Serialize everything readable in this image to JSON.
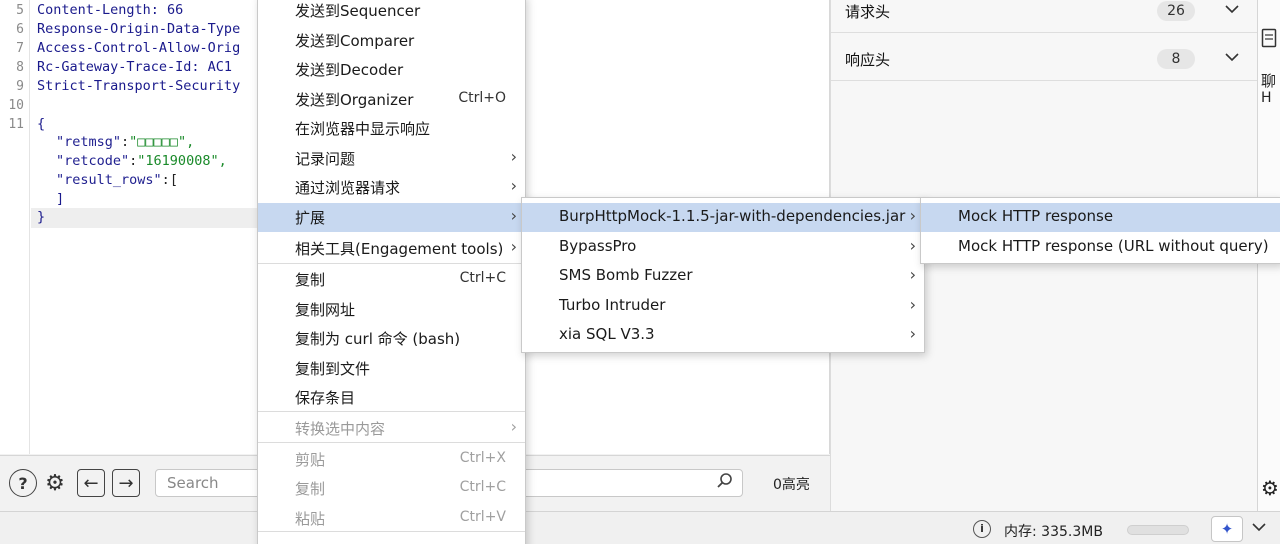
{
  "editor": {
    "line_numbers": [
      "5",
      "6",
      "7",
      "8",
      "9",
      "10",
      "11"
    ],
    "lines": [
      "Content-Length: 66",
      "Response-Origin-Data-Type",
      "Access-Control-Allow-Orig",
      "Rc-Gateway-Trace-Id: AC1",
      "Strict-Transport-Security",
      "",
      "{"
    ],
    "json_lines": [
      {
        "key": "\"retmsg\"",
        "value": "\"□□□□□\","
      },
      {
        "key": "\"retcode\"",
        "value": "\"16190008\","
      },
      {
        "key": "\"result_rows\"",
        "value": "["
      }
    ],
    "close_bracket": "]",
    "close_brace": "}"
  },
  "toolbar": {
    "search_placeholder": "Search",
    "highlight_count": "0高亮"
  },
  "inspector": {
    "rows": [
      {
        "label": "请求头",
        "count": "26"
      },
      {
        "label": "响应头",
        "count": "8"
      }
    ]
  },
  "rightstrip": {
    "text1": "聊",
    "text2": "H"
  },
  "statusbar": {
    "memory": "内存: 335.3MB"
  },
  "menu_main": {
    "items": [
      {
        "label": "发送到Sequencer",
        "shortcut": ""
      },
      {
        "label": "发送到Comparer",
        "shortcut": ""
      },
      {
        "label": "发送到Decoder",
        "shortcut": ""
      },
      {
        "label": "发送到Organizer",
        "shortcut": "Ctrl+O"
      },
      {
        "label": "在浏览器中显示响应",
        "shortcut": ""
      },
      {
        "label": "记录问题",
        "shortcut": ""
      },
      {
        "label": "通过浏览器请求",
        "shortcut": ""
      },
      {
        "label": "扩展",
        "shortcut": ""
      },
      {
        "label": "相关工具(Engagement tools)",
        "shortcut": ""
      },
      {
        "label": "复制",
        "shortcut": "Ctrl+C"
      },
      {
        "label": "复制网址",
        "shortcut": ""
      },
      {
        "label": "复制为 curl 命令 (bash)",
        "shortcut": ""
      },
      {
        "label": "复制到文件",
        "shortcut": ""
      },
      {
        "label": "保存条目",
        "shortcut": ""
      },
      {
        "label": "转换选中内容",
        "shortcut": ""
      },
      {
        "label": "剪贴",
        "shortcut": "Ctrl+X"
      },
      {
        "label": "复制",
        "shortcut": "Ctrl+C"
      },
      {
        "label": "粘贴",
        "shortcut": "Ctrl+V"
      }
    ]
  },
  "menu_ext": {
    "items": [
      {
        "label": "BurpHttpMock-1.1.5-jar-with-dependencies.jar"
      },
      {
        "label": "BypassPro"
      },
      {
        "label": "SMS Bomb Fuzzer"
      },
      {
        "label": "Turbo Intruder"
      },
      {
        "label": "xia SQL V3.3"
      }
    ]
  },
  "menu_mock": {
    "items": [
      {
        "label": "Mock HTTP response"
      },
      {
        "label": "Mock HTTP response (URL without query)"
      }
    ]
  },
  "colors": {
    "selected": "#c7d8f0",
    "string_green": "#1a8a2a",
    "key_blue": "#1f1f8f"
  }
}
